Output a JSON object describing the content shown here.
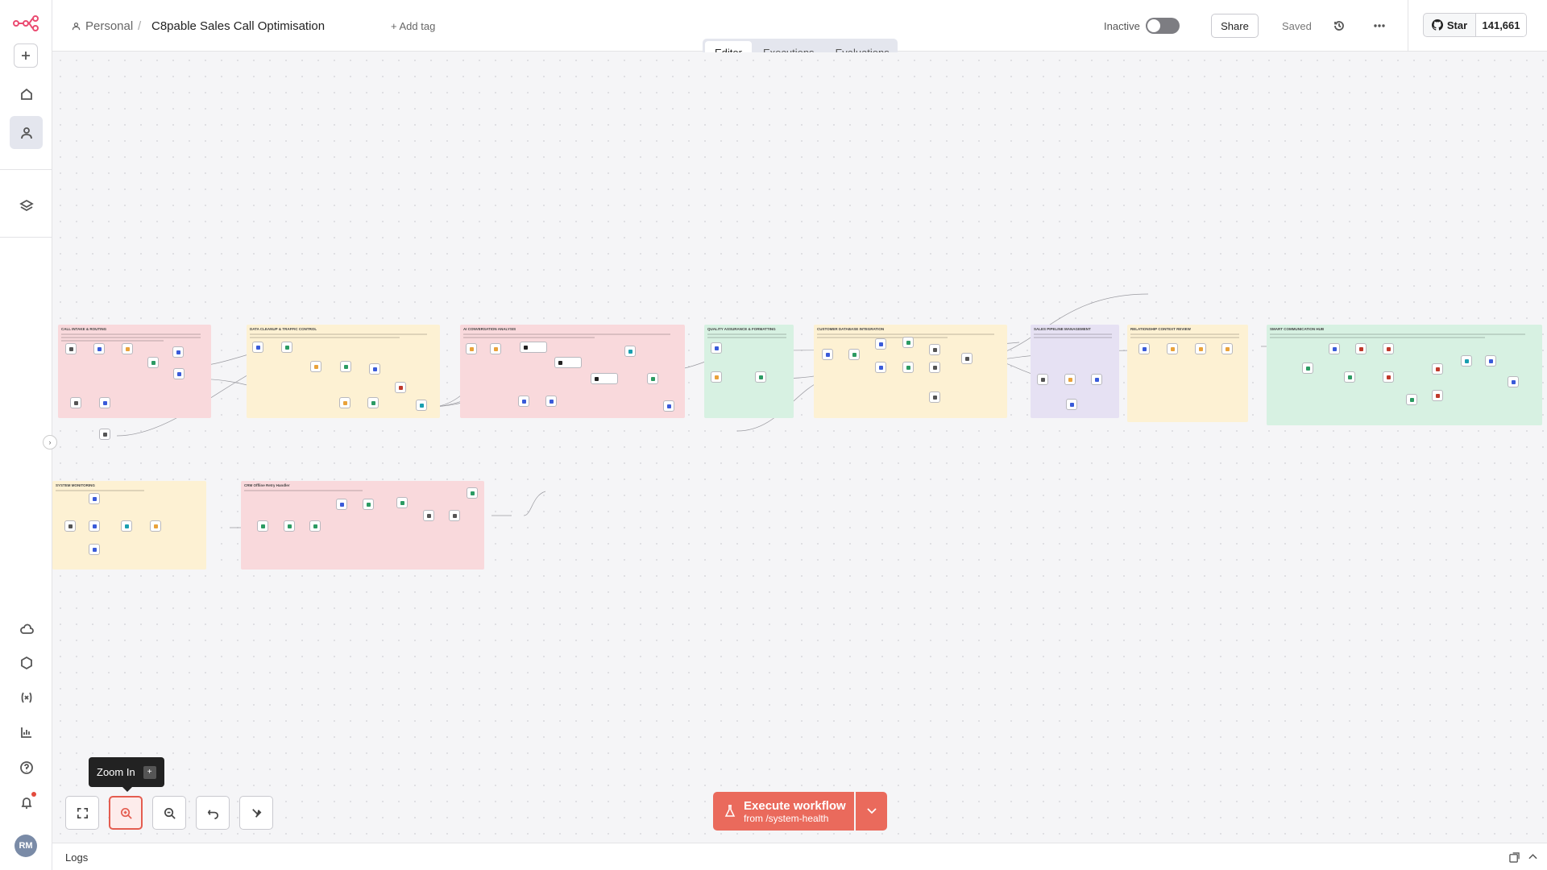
{
  "header": {
    "project": "Personal",
    "separator": "/",
    "workflow_title": "C8pable Sales Call Optimisation",
    "add_tag": "+ Add tag",
    "status_label": "Inactive",
    "share_label": "Share",
    "saved_label": "Saved",
    "github_star_label": "Star",
    "github_star_count": "141,661"
  },
  "tabs": [
    {
      "label": "Editor",
      "active": true
    },
    {
      "label": "Executions",
      "active": false
    },
    {
      "label": "Evaluations",
      "active": false
    }
  ],
  "canvas": {
    "sticky_notes": [
      {
        "title": "CALL INTAKE & ROUTING",
        "color": "#f9d9dc"
      },
      {
        "title": "DATA CLEANUP & TRAFFIC CONTROL",
        "color": "#fdf1d3"
      },
      {
        "title": "AI CONVERSATION ANALYSIS",
        "color": "#f9d9dc"
      },
      {
        "title": "QUALITY ASSURANCE & FORMATTING",
        "color": "#d7f1e2"
      },
      {
        "title": "CUSTOMER DATABASE INTEGRATION",
        "color": "#fdf1d3"
      },
      {
        "title": "SALES PIPELINE MANAGEMENT",
        "color": "#e6e1f3"
      },
      {
        "title": "RELATIONSHIP CONTEXT REVIEW",
        "color": "#fdf1d3"
      },
      {
        "title": "SMART COMMUNICATION HUB",
        "color": "#d7f1e2"
      },
      {
        "title": "SYSTEM MONITORING",
        "color": "#fdf1d3"
      },
      {
        "title": "CRM Offline Retry Handler",
        "color": "#f9d9dc"
      }
    ]
  },
  "zoom_tooltip": {
    "label": "Zoom In",
    "shortcut": "+"
  },
  "execute": {
    "label": "Execute workflow",
    "sub": "from /system-health"
  },
  "logs": {
    "label": "Logs"
  },
  "user": {
    "initials": "RM"
  }
}
